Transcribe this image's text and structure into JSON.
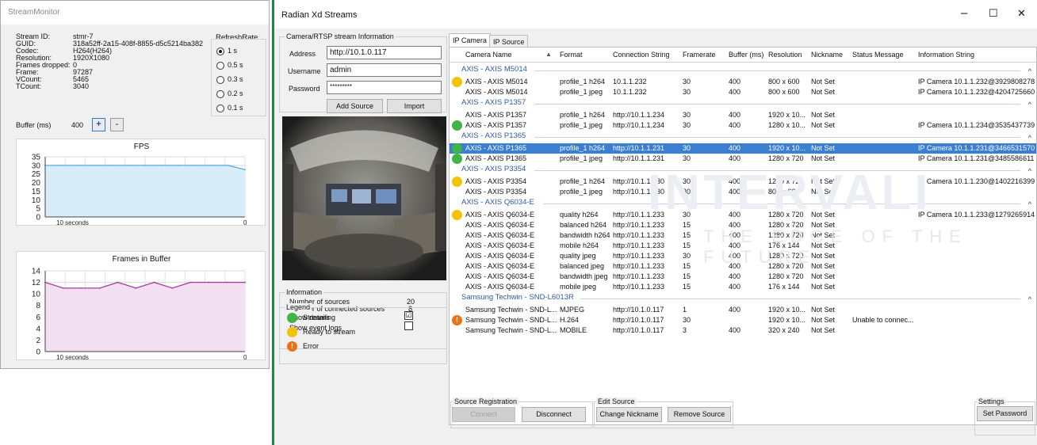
{
  "colors": {
    "streaming": "#3fb449",
    "ready": "#f3c300",
    "error": "#ee6f16",
    "selection": "#3a7fd1",
    "accent_border": "#1e8a3b"
  },
  "stream_monitor": {
    "title": "StreamMonitor",
    "info": [
      {
        "label": "Stream ID:",
        "value": "stmr-7"
      },
      {
        "label": "GUID:",
        "value": "318a52ff-2a15-408f-8855-d5c5214ba382"
      },
      {
        "label": "Codec:",
        "value": "H264(H264)"
      },
      {
        "label": "Resolution:",
        "value": "1920X1080"
      },
      {
        "label": "Frames dropped:",
        "value": "0"
      },
      {
        "label": "Frame:",
        "value": "97287"
      },
      {
        "label": "VCount:",
        "value": "5465"
      },
      {
        "label": "TCount:",
        "value": "3040"
      }
    ],
    "refresh_title": "RefreshRate",
    "refresh_options": [
      "1 s",
      "0.5 s",
      "0.3 s",
      "0.2 s",
      "0.1 s"
    ],
    "refresh_selected": 0,
    "buffer_label": "Buffer (ms)",
    "buffer_value": "400",
    "plus": "+",
    "minus": "-",
    "charts": [
      {
        "type": "area",
        "title": "FPS",
        "yticks": [
          35,
          30,
          25,
          20,
          15,
          10,
          5,
          0
        ],
        "ylim": [
          0,
          35
        ],
        "x_left_label": "10 seconds",
        "x_right_label": "0",
        "values": [
          30,
          30,
          30,
          30,
          30,
          30,
          30,
          30,
          30,
          30,
          30,
          30,
          27.5
        ],
        "fill": "#d9ecfa",
        "stroke": "#5ba8e0"
      },
      {
        "type": "area",
        "title": "Frames in Buffer",
        "yticks": [
          14,
          12,
          10,
          8,
          6,
          4,
          2,
          0
        ],
        "ylim": [
          0,
          14
        ],
        "x_left_label": "10 seconds",
        "x_right_label": "0",
        "values": [
          12,
          11,
          11,
          11,
          12,
          11,
          12,
          11,
          12,
          12,
          12,
          12
        ],
        "fill": "#f2dff2",
        "stroke": "#a43fa4"
      }
    ]
  },
  "radian": {
    "title": "Radian Xd Streams",
    "controls": {
      "min": "–",
      "max": "☐",
      "close": "✕"
    },
    "camera_group": {
      "title": "Camera/RTSP stream Information",
      "address_label": "Address",
      "address_value": "http://10.1.0.117",
      "username_label": "Username",
      "username_value": "admin",
      "password_label": "Password",
      "password_value": "*********",
      "add_source": "Add Source",
      "import": "Import"
    },
    "info_group": {
      "title": "Information",
      "num_sources_label": "Number of sources",
      "num_sources": "20",
      "num_connected_label": "Number of connected sources",
      "num_connected": "8",
      "show_details": "Show details",
      "show_details_checked": "☑",
      "show_event_logs": "Show event logs"
    },
    "legend": {
      "title": "Legend",
      "items": [
        {
          "label": "Streaming",
          "status": "streaming"
        },
        {
          "label": "Ready to stream",
          "status": "ready"
        },
        {
          "label": "Error",
          "status": "error"
        }
      ]
    },
    "tabs": [
      "IP Camera",
      "IP Source"
    ],
    "active_tab": 0,
    "headers": [
      "Camera Name",
      "Format",
      "Connection String",
      "Framerate",
      "Buffer (ms)",
      "Resolution",
      "Nickname",
      "Status Message",
      "Information String"
    ],
    "sort_arrow": "▲",
    "groups": [
      {
        "name": "AXIS - AXIS M5014",
        "rows": [
          {
            "status": "ready",
            "camera": "AXIS - AXIS M5014",
            "format": "profile_1 h264",
            "conn": "10.1.1.232",
            "fr": "30",
            "buf": "400",
            "res": "800 x 600",
            "nick": "Not Set",
            "msg": "",
            "info": "IP Camera 10.1.1.232@3929808278"
          },
          {
            "status": "",
            "camera": "AXIS - AXIS M5014",
            "format": "profile_1 jpeg",
            "conn": "10.1.1.232",
            "fr": "30",
            "buf": "400",
            "res": "800 x 600",
            "nick": "Not Set",
            "msg": "",
            "info": "IP Camera 10.1.1.232@4204725660"
          }
        ]
      },
      {
        "name": "AXIS - AXIS P1357",
        "rows": [
          {
            "status": "",
            "camera": "AXIS - AXIS P1357",
            "format": "profile_1 h264",
            "conn": "http://10.1.1.234",
            "fr": "30",
            "buf": "400",
            "res": "1920 x 10...",
            "nick": "Not Set",
            "msg": "",
            "info": ""
          },
          {
            "status": "streaming",
            "camera": "AXIS - AXIS P1357",
            "format": "profile_1 jpeg",
            "conn": "http://10.1.1.234",
            "fr": "30",
            "buf": "400",
            "res": "1280 x 10...",
            "nick": "Not Set",
            "msg": "",
            "info": "IP Camera 10.1.1.234@3535437739"
          }
        ]
      },
      {
        "name": "AXIS - AXIS P1365",
        "rows": [
          {
            "status": "streaming",
            "camera": "AXIS - AXIS P1365",
            "format": "profile_1 h264",
            "conn": "http://10.1.1.231",
            "fr": "30",
            "buf": "400",
            "res": "1920 x 10...",
            "nick": "Not Set",
            "msg": "",
            "info": "IP Camera 10.1.1.231@3466531570",
            "selected": true
          },
          {
            "status": "streaming",
            "camera": "AXIS - AXIS P1365",
            "format": "profile_1 jpeg",
            "conn": "http://10.1.1.231",
            "fr": "30",
            "buf": "400",
            "res": "1280 x 720",
            "nick": "Not Set",
            "msg": "",
            "info": "IP Camera 10.1.1.231@3485586611"
          }
        ]
      },
      {
        "name": "AXIS - AXIS P3354",
        "rows": [
          {
            "status": "ready",
            "camera": "AXIS - AXIS P3354",
            "format": "profile_1 h264",
            "conn": "http://10.1.1.230",
            "fr": "30",
            "buf": "400",
            "res": "1280 x 720",
            "nick": "Not Set",
            "msg": "",
            "info": "IP Camera 10.1.1.230@1402216399"
          },
          {
            "status": "",
            "camera": "AXIS - AXIS P3354",
            "format": "profile_1 jpeg",
            "conn": "http://10.1.1.230",
            "fr": "30",
            "buf": "400",
            "res": "800 x 600",
            "nick": "Not Set",
            "msg": "",
            "info": ""
          }
        ]
      },
      {
        "name": "AXIS - AXIS Q6034-E",
        "rows": [
          {
            "status": "ready",
            "camera": "AXIS - AXIS Q6034-E",
            "format": "quality h264",
            "conn": "http://10.1.1.233",
            "fr": "30",
            "buf": "400",
            "res": "1280 x 720",
            "nick": "Not Set",
            "msg": "",
            "info": "IP Camera 10.1.1.233@1279265914"
          },
          {
            "status": "",
            "camera": "AXIS - AXIS Q6034-E",
            "format": "balanced h264",
            "conn": "http://10.1.1.233",
            "fr": "15",
            "buf": "400",
            "res": "1280 x 720",
            "nick": "Not Set",
            "msg": "",
            "info": ""
          },
          {
            "status": "",
            "camera": "AXIS - AXIS Q6034-E",
            "format": "bandwidth h264",
            "conn": "http://10.1.1.233",
            "fr": "15",
            "buf": "400",
            "res": "1280 x 720",
            "nick": "Not Set",
            "msg": "",
            "info": ""
          },
          {
            "status": "",
            "camera": "AXIS - AXIS Q6034-E",
            "format": "mobile h264",
            "conn": "http://10.1.1.233",
            "fr": "15",
            "buf": "400",
            "res": "176 x 144",
            "nick": "Not Set",
            "msg": "",
            "info": ""
          },
          {
            "status": "",
            "camera": "AXIS - AXIS Q6034-E",
            "format": "quality jpeg",
            "conn": "http://10.1.1.233",
            "fr": "30",
            "buf": "400",
            "res": "1280 x 720",
            "nick": "Not Set",
            "msg": "",
            "info": ""
          },
          {
            "status": "",
            "camera": "AXIS - AXIS Q6034-E",
            "format": "balanced jpeg",
            "conn": "http://10.1.1.233",
            "fr": "15",
            "buf": "400",
            "res": "1280 x 720",
            "nick": "Not Set",
            "msg": "",
            "info": ""
          },
          {
            "status": "",
            "camera": "AXIS - AXIS Q6034-E",
            "format": "bandwidth jpeg",
            "conn": "http://10.1.1.233",
            "fr": "15",
            "buf": "400",
            "res": "1280 x 720",
            "nick": "Not Set",
            "msg": "",
            "info": ""
          },
          {
            "status": "",
            "camera": "AXIS - AXIS Q6034-E",
            "format": "mobile jpeg",
            "conn": "http://10.1.1.233",
            "fr": "15",
            "buf": "400",
            "res": "176 x 144",
            "nick": "Not Set",
            "msg": "",
            "info": ""
          }
        ]
      },
      {
        "name": "Samsung Techwin - SND-L6013R",
        "rows": [
          {
            "status": "",
            "camera": "Samsung Techwin - SND-L...",
            "format": "MJPEG",
            "conn": "http://10.1.0.117",
            "fr": "1",
            "buf": "400",
            "res": "1920 x 10...",
            "nick": "Not Set",
            "msg": "",
            "info": ""
          },
          {
            "status": "error",
            "camera": "Samsung Techwin - SND-L...",
            "format": "H.264",
            "conn": "http://10.1.0.117",
            "fr": "30",
            "buf": "",
            "res": "1920 x 10...",
            "nick": "Not Set",
            "msg": "Unable to connec...",
            "info": ""
          },
          {
            "status": "",
            "camera": "Samsung Techwin - SND-L...",
            "format": "MOBILE",
            "conn": "http://10.1.0.117",
            "fr": "3",
            "buf": "400",
            "res": "320 x 240",
            "nick": "Not Set",
            "msg": "",
            "info": ""
          }
        ]
      }
    ],
    "group_caret": "^",
    "watermark": "THE EDGE OF THE FUTURE",
    "source_registration": {
      "title": "Source Registration",
      "connect": "Connect",
      "disconnect": "Disconnect"
    },
    "edit_source": {
      "title": "Edit Source",
      "change_nickname": "Change Nickname",
      "remove_source": "Remove Source"
    },
    "settings": {
      "title": "Settings",
      "set_password": "Set Password"
    }
  }
}
